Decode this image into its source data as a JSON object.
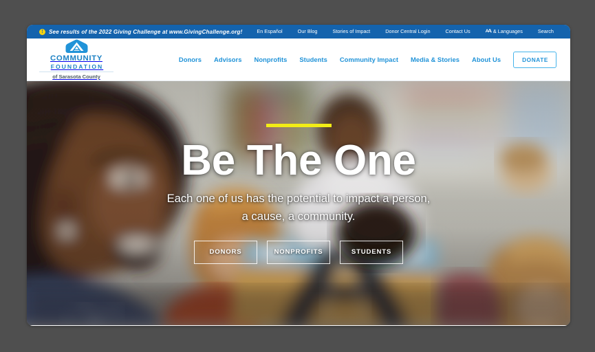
{
  "utility_bar": {
    "info_icon": "info-icon",
    "promo_text": "See results of the 2022 Giving Challenge at www.GivingChallenge.org!",
    "links": [
      {
        "label": "En Español",
        "name": "utility-link-en-espanol"
      },
      {
        "label": "Our Blog",
        "name": "utility-link-our-blog"
      },
      {
        "label": "Stories of Impact",
        "name": "utility-link-stories-of-impact"
      },
      {
        "label": "Donor Central Login",
        "name": "utility-link-donor-central-login"
      },
      {
        "label": "Contact Us",
        "name": "utility-link-contact-us"
      },
      {
        "label": "& Languages",
        "name": "utility-link-languages",
        "icon": "translate-icon"
      },
      {
        "label": "Search",
        "name": "utility-link-search"
      }
    ],
    "background_color": "#1463ad",
    "text_color": "#ffffff",
    "info_icon_color": "#f5d311"
  },
  "header": {
    "logo": {
      "icon": "community-foundation-roof-logo",
      "line1": "COMMUNITY",
      "line2": "FOUNDATION",
      "line3": "of Sarasota County",
      "color": "#1c81c4"
    },
    "nav": [
      {
        "label": "Donors",
        "name": "nav-link-donors"
      },
      {
        "label": "Advisors",
        "name": "nav-link-advisors"
      },
      {
        "label": "Nonprofits",
        "name": "nav-link-nonprofits"
      },
      {
        "label": "Students",
        "name": "nav-link-students"
      },
      {
        "label": "Community Impact",
        "name": "nav-link-community-impact"
      },
      {
        "label": "Media & Stories",
        "name": "nav-link-media-stories"
      },
      {
        "label": "About Us",
        "name": "nav-link-about-us"
      }
    ],
    "donate_label": "DONATE",
    "nav_color": "#2193d8",
    "donate_border_color": "#45b3ea"
  },
  "hero": {
    "accent_bar_color": "#f2ec16",
    "title": "Be The One",
    "subtitle_line1": "Each one of us has the potential to impact a person,",
    "subtitle_line2": "a cause, a community.",
    "buttons": [
      {
        "label": "DONORS",
        "name": "hero-cta-donors"
      },
      {
        "label": "NONPROFITS",
        "name": "hero-cta-nonprofits"
      },
      {
        "label": "STUDENTS",
        "name": "hero-cta-students"
      }
    ],
    "image_description": "blurred classroom photo with children and teacher"
  },
  "desktop": {
    "background_color": "#4f4f4f"
  }
}
